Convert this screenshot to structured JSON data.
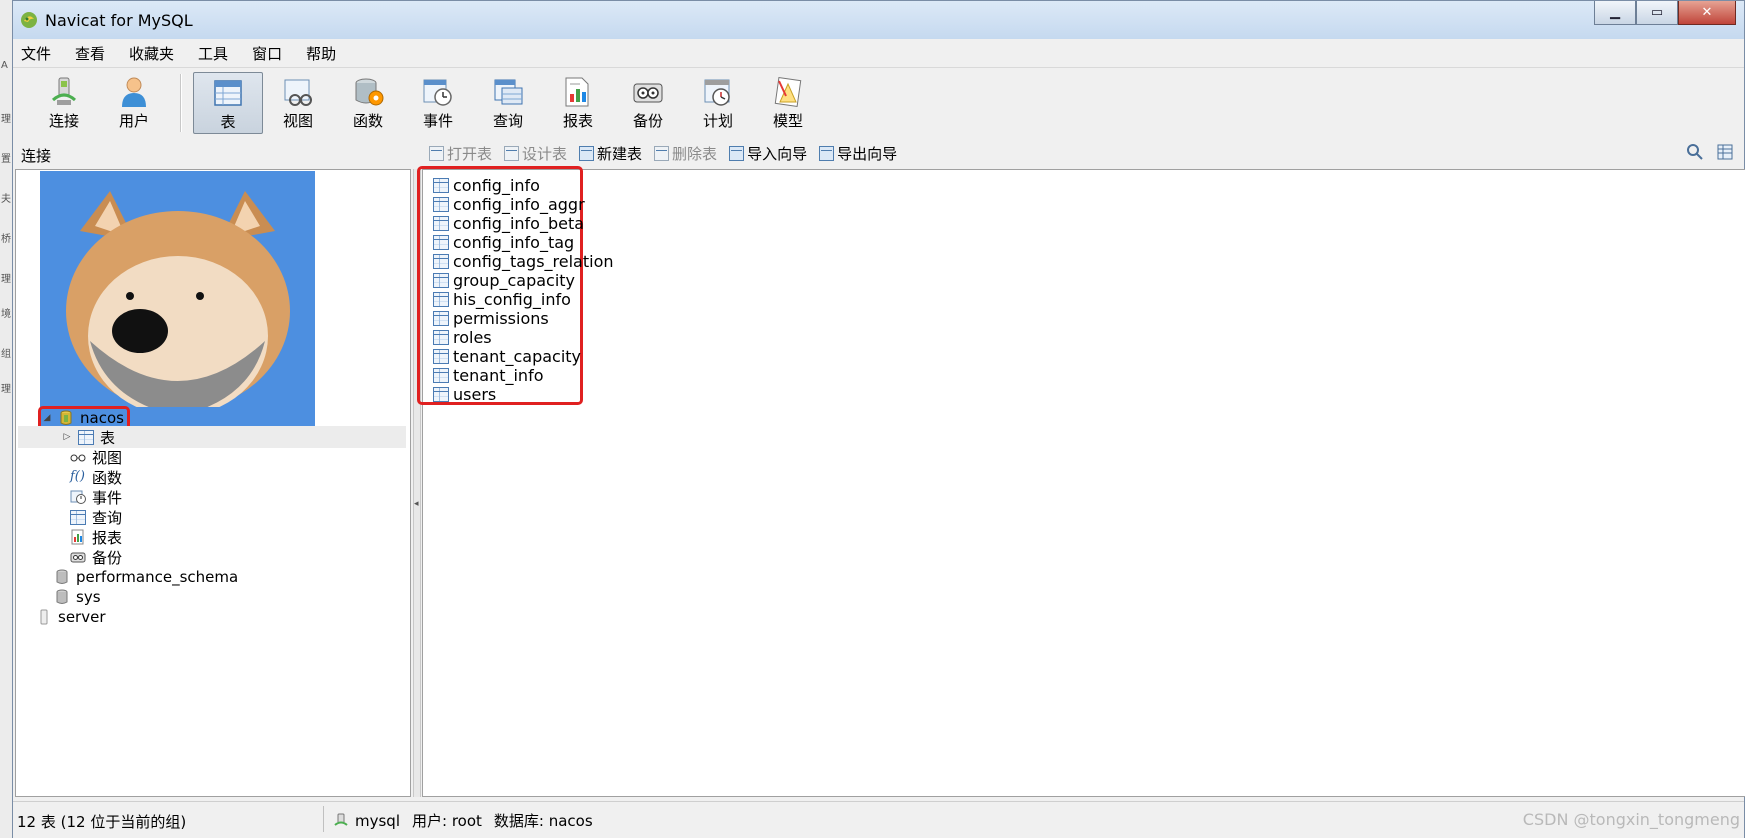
{
  "window": {
    "title": "Navicat for MySQL"
  },
  "menu": [
    "文件",
    "查看",
    "收藏夹",
    "工具",
    "窗口",
    "帮助"
  ],
  "toolbar": {
    "buttons": [
      {
        "label": "连接",
        "icon": "connect-icon"
      },
      {
        "label": "用户",
        "icon": "user-icon"
      },
      {
        "label": "表",
        "icon": "table-icon",
        "active": true
      },
      {
        "label": "视图",
        "icon": "view-icon"
      },
      {
        "label": "函数",
        "icon": "function-icon"
      },
      {
        "label": "事件",
        "icon": "event-icon"
      },
      {
        "label": "查询",
        "icon": "query-icon"
      },
      {
        "label": "报表",
        "icon": "report-icon"
      },
      {
        "label": "备份",
        "icon": "backup-icon"
      },
      {
        "label": "计划",
        "icon": "schedule-icon"
      },
      {
        "label": "模型",
        "icon": "model-icon"
      }
    ]
  },
  "subbar": {
    "connection_label": "连接",
    "actions": [
      {
        "label": "打开表",
        "enabled": false
      },
      {
        "label": "设计表",
        "enabled": false
      },
      {
        "label": "新建表",
        "enabled": true
      },
      {
        "label": "删除表",
        "enabled": false
      },
      {
        "label": "导入向导",
        "enabled": true
      },
      {
        "label": "导出向导",
        "enabled": true
      }
    ]
  },
  "tree": {
    "database": "nacos",
    "children": [
      "表",
      "视图",
      "函数",
      "事件",
      "查询",
      "报表",
      "备份"
    ],
    "other_databases": [
      "performance_schema",
      "sys"
    ],
    "other_connection": "server"
  },
  "tables": [
    "config_info",
    "config_info_aggr",
    "config_info_beta",
    "config_info_tag",
    "config_tags_relation",
    "group_capacity",
    "his_config_info",
    "permissions",
    "roles",
    "tenant_capacity",
    "tenant_info",
    "users"
  ],
  "status": {
    "count_text": "12 表 (12 位于当前的组)",
    "connection": "mysql",
    "user": "用户: root",
    "database": "数据库: nacos"
  },
  "watermark": "CSDN @tongxin_tongmeng",
  "colors": {
    "highlight_box": "#e02020",
    "titlebar": "#c5d9ef",
    "table_icon": "#4b7bb3"
  }
}
